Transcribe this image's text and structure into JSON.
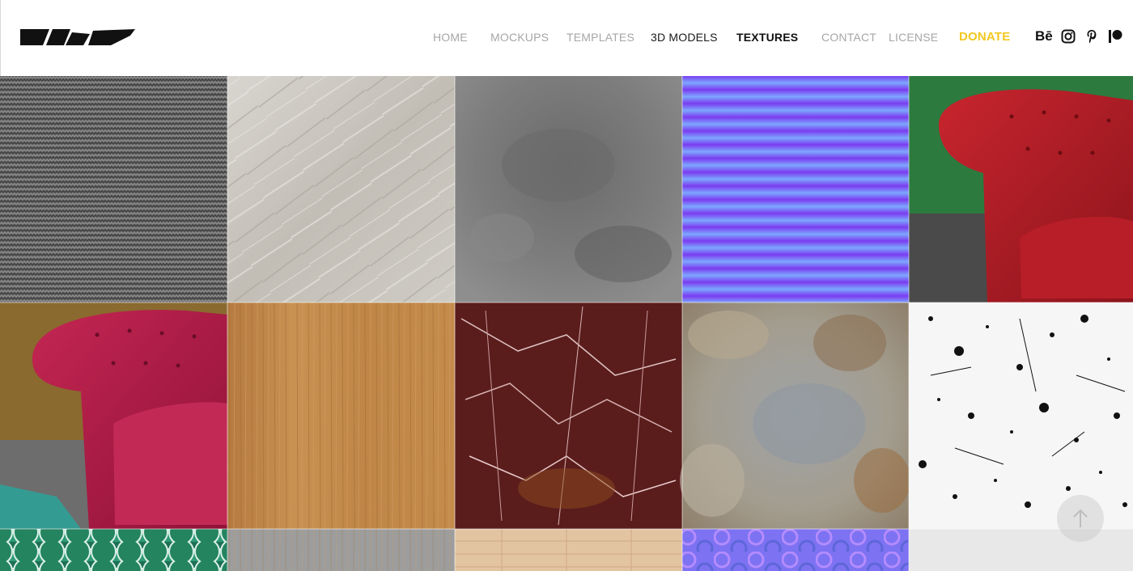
{
  "nav": {
    "items": [
      {
        "label": "HOME",
        "state": "normal"
      },
      {
        "label": "MOCKUPS",
        "state": "normal"
      },
      {
        "label": "TEMPLATES",
        "state": "normal"
      },
      {
        "label": "3D MODELS",
        "state": "dark"
      },
      {
        "label": "TEXTURES",
        "state": "active"
      },
      {
        "label": "CONTACT",
        "state": "normal"
      },
      {
        "label": "LICENSE",
        "state": "normal"
      },
      {
        "label": "DONATE",
        "state": "donate"
      }
    ],
    "behance_label": "Bē"
  },
  "social": [
    "behance-icon",
    "instagram-icon",
    "pinterest-icon",
    "patreon-icon"
  ],
  "textures": [
    {
      "name": "grey-knit-fabric",
      "color": "#6a6a6a"
    },
    {
      "name": "light-stone",
      "color": "#c9c6c0"
    },
    {
      "name": "grey-concrete",
      "color": "#7a7a7a"
    },
    {
      "name": "normal-map-stripes",
      "color": "#7a6cf0"
    },
    {
      "name": "red-leather-chesterfield",
      "color": "#b0202a"
    },
    {
      "name": "pink-velvet-chesterfield",
      "color": "#b51e45"
    },
    {
      "name": "oak-wood",
      "color": "#c0894a"
    },
    {
      "name": "red-marble",
      "color": "#5a1d1c"
    },
    {
      "name": "rusty-plaster",
      "color": "#9a958a"
    },
    {
      "name": "black-splatter-grunge",
      "color": "#f4f4f4"
    },
    {
      "name": "green-fish-scale-tiles",
      "color": "#1d7a5a"
    },
    {
      "name": "grey-wood",
      "color": "#9c9c9c"
    },
    {
      "name": "light-wood-planks",
      "color": "#e2c3a0"
    },
    {
      "name": "normal-map-dots",
      "color": "#7a70f0"
    },
    {
      "name": "light-grey",
      "color": "#e6e6e6"
    }
  ],
  "accent": "#f2c81f"
}
